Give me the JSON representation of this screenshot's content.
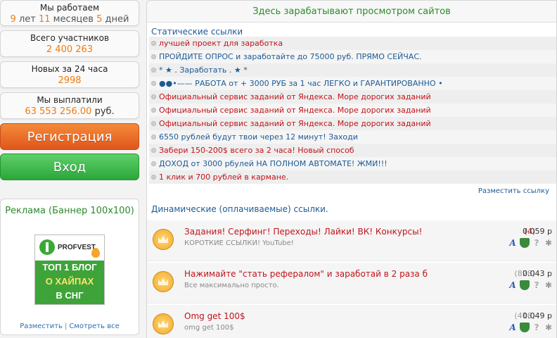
{
  "stats": [
    {
      "label": "Мы работаем",
      "parts": [
        "9",
        " лет ",
        "11",
        " месяцев ",
        "5",
        " дней"
      ]
    },
    {
      "label": "Всего участников",
      "value": "2 400 263"
    },
    {
      "label": "Новых за 24 часа",
      "value": "2998"
    },
    {
      "label": "Мы выплатили",
      "value": "63 553 256.00",
      "unit": " руб."
    }
  ],
  "buttons": {
    "register": "Регистрация",
    "login": "Вход"
  },
  "ad": {
    "title": "Реклама (Баннер 100x100)",
    "banner_brand": "PROFVEST",
    "banner_lines": [
      "ТОП 1 БЛОГ",
      "О ХАЙПАХ",
      "В СНГ"
    ],
    "place": "Разместить",
    "sep": "|",
    "view_all": "Смотреть все"
  },
  "main": {
    "header": "Здесь зарабатывают просмотром сайтов",
    "static_title": "Статические ссылки",
    "static_links": [
      {
        "text": "лучшей проект для заработка",
        "color": "red"
      },
      {
        "text": "ПРОЙДИТЕ ОПРОС и заработайте до 75000 руб. ПРЯМО СЕЙЧАС.",
        "color": "blue"
      },
      {
        "text": "* ★ . Заработать . ★ *",
        "color": "blue"
      },
      {
        "text": "●●•—— РАБОТА от + 3000 РУБ за 1 час ЛЕГКО и ГАРАНТИРОВАННО •",
        "color": "blue"
      },
      {
        "text": "Официальный сервис заданий от Яндекса. Море дорогих заданий",
        "color": "red"
      },
      {
        "text": "Официальный сервис заданий от Яндекса. Море дорогих заданий",
        "color": "red"
      },
      {
        "text": "Официальный сервис заданий от Яндекса. Море дорогих заданий",
        "color": "red"
      },
      {
        "text": "6550 рублей будут твои через 12 минут! Заходи",
        "color": "blue"
      },
      {
        "text": "Забери 150-200$ всего за 2 часа! Новый способ",
        "color": "red"
      },
      {
        "text": "ДОХОД от 3000 рбулей НА ПОЛНОМ АВТОМАТЕ! ЖМИ!!!",
        "color": "blue"
      },
      {
        "text": "1 клик и 700 рублей в кармане.",
        "color": "red"
      }
    ],
    "place_link": "Разместить ссылку",
    "dynamic_title": "Динамические (оплачиваемые) ссылки.",
    "dynamic_links": [
      {
        "title": "Задания! Серфинг! Переходы! Лайки! ВК! Конкурсы!",
        "subtitle": "КОРОТКИЕ ССЫЛКИ! YouTube!",
        "count": "(4)",
        "count_red": true,
        "price": "0.059 р"
      },
      {
        "title": "Нажимайте \"стать рефералом\" и заработай в 2 раза б",
        "subtitle": "Все максимально просто.",
        "count": "(828)",
        "count_red": false,
        "price": "0.043 р"
      },
      {
        "title": "Omg get 100$",
        "subtitle": "omg get 100$",
        "count": "(418)",
        "count_red": false,
        "price": "0.049 р"
      }
    ]
  },
  "colors": {
    "accent_orange": "#f07c10",
    "green": "#2b8a2b",
    "link_blue": "#1d5a94",
    "red": "#c0141a"
  }
}
